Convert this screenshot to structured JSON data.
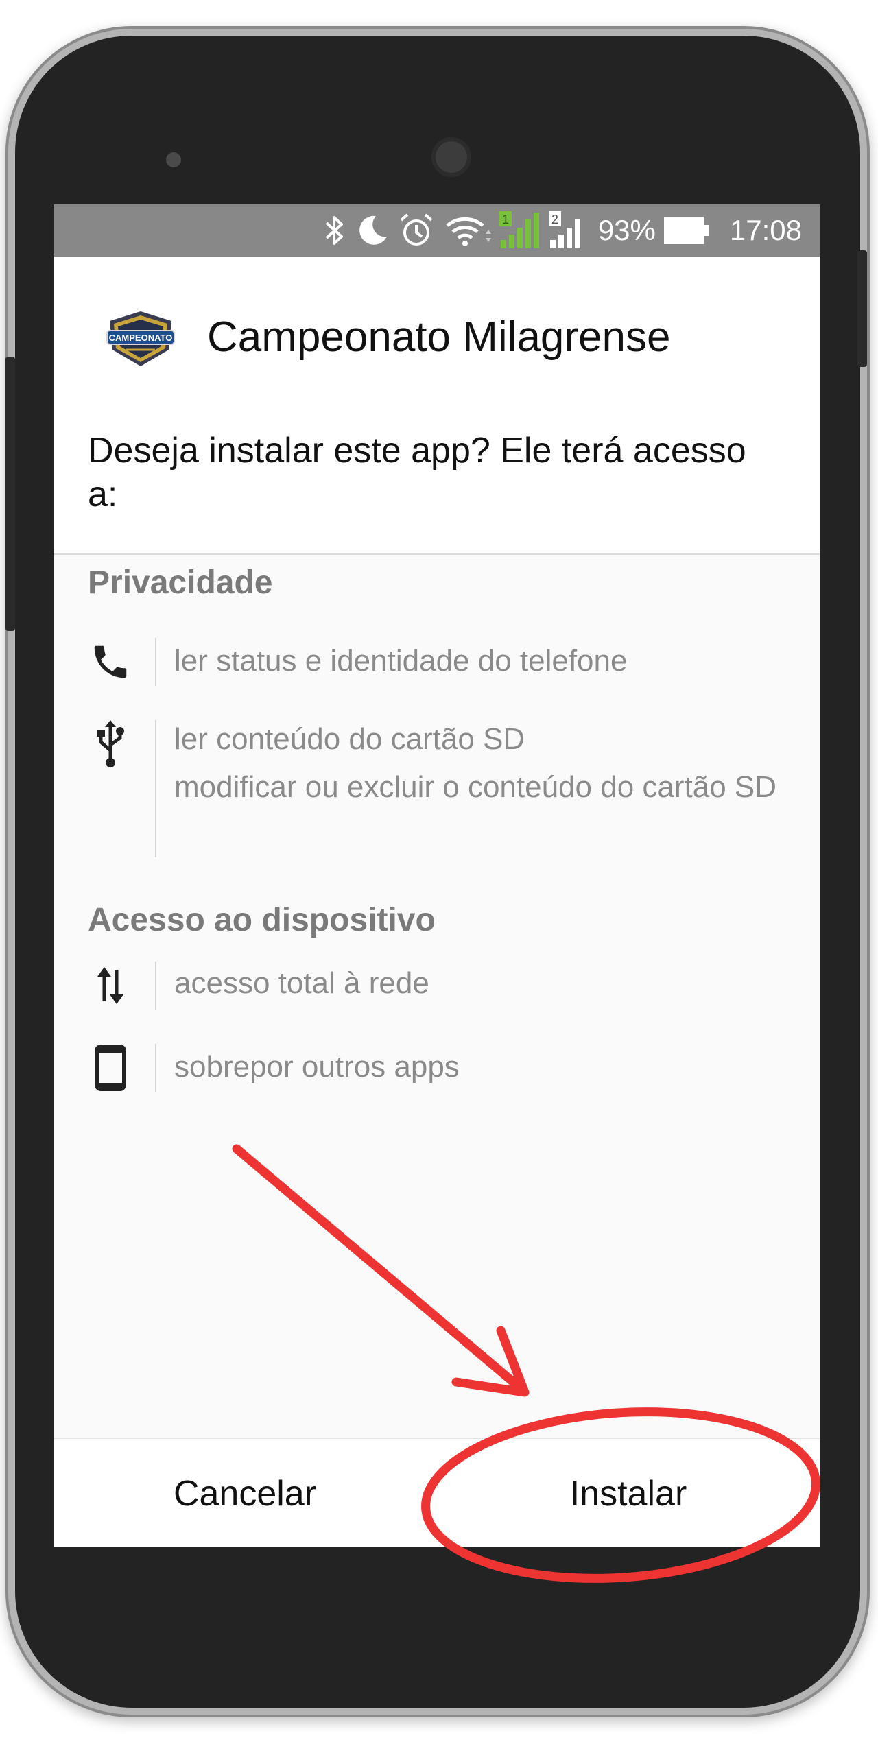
{
  "status_bar": {
    "battery_percent": "93%",
    "time": "17:08",
    "icons": [
      "bluetooth-icon",
      "moon-icon",
      "alarm-icon",
      "wifi-icon",
      "sim1-signal-icon",
      "sim2-signal-icon",
      "battery-icon"
    ],
    "sim1_label": "1",
    "sim2_label": "2"
  },
  "app": {
    "name": "Campeonato Milagrense",
    "icon_text": "CAMPEONATO"
  },
  "question": "Deseja instalar este app? Ele terá acesso a:",
  "sections": [
    {
      "title": "Privacidade",
      "items": [
        {
          "icon": "phone-icon",
          "lines": [
            "ler status e identidade do telefone"
          ]
        },
        {
          "icon": "usb-icon",
          "lines": [
            "ler conteúdo do cartão SD",
            "modificar ou excluir o conteúdo do cartão SD"
          ]
        }
      ]
    },
    {
      "title": "Acesso ao dispositivo",
      "items": [
        {
          "icon": "network-arrows-icon",
          "lines": [
            "acesso total à rede"
          ]
        },
        {
          "icon": "device-icon",
          "lines": [
            "sobrepor outros apps"
          ]
        }
      ]
    }
  ],
  "buttons": {
    "cancel": "Cancelar",
    "install": "Instalar"
  },
  "colors": {
    "annotation": "#ee3333",
    "status_bar": "#888888",
    "signal_green": "#7ac13b"
  }
}
